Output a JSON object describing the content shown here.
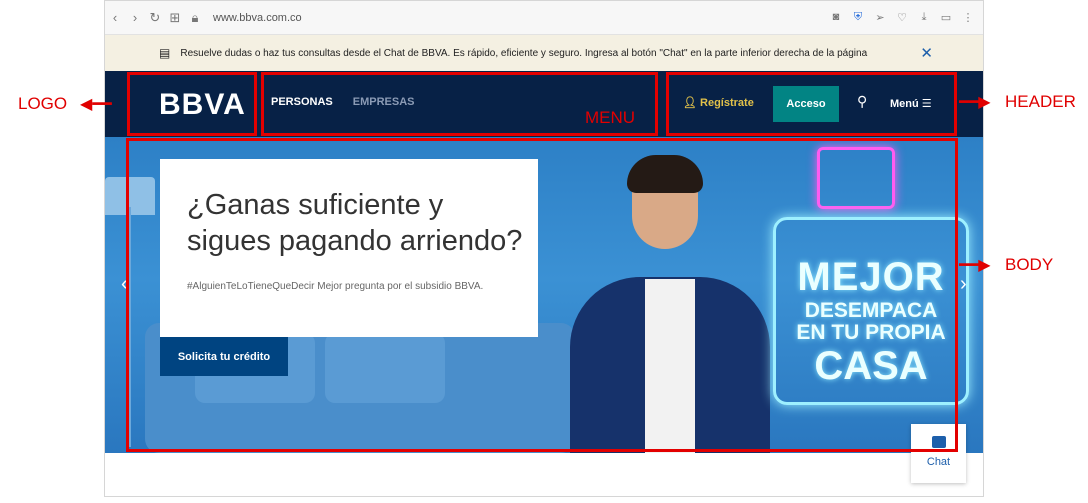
{
  "browser": {
    "url": "www.bbva.com.co",
    "nav_icons": [
      "back-icon",
      "forward-icon",
      "reload-icon",
      "apps-icon",
      "lock-icon"
    ],
    "toolbar_icons": [
      "camera-icon",
      "shield-icon",
      "send-icon",
      "heart-icon",
      "download-icon",
      "battery-icon",
      "more-icon"
    ]
  },
  "chat_banner": {
    "text": "Resuelve dudas o haz tus consultas desde el Chat de BBVA. Es rápido, eficiente y seguro. Ingresa al botón \"Chat\" en la parte inferior derecha de la página",
    "close": "✕"
  },
  "header": {
    "logo": "BBVA",
    "nav": [
      {
        "label": "PERSONAS",
        "active": true
      },
      {
        "label": "EMPRESAS",
        "active": false
      }
    ],
    "registrate": "Regístrate",
    "acceso": "Acceso",
    "menu": "Menú"
  },
  "hero": {
    "title": "¿Ganas suficiente y sigues pagando arriendo?",
    "subtitle": "#AlguienTeLoTieneQueDecir Mejor pregunta por el subsidio BBVA.",
    "cta": "Solicita tu crédito",
    "neon_line1": "MEJOR",
    "neon_line2": "DESEMPACA",
    "neon_line3": "EN TU PROPIA",
    "neon_line4": "CASA"
  },
  "chat_button": {
    "label": "Chat"
  },
  "annotations": {
    "logo": "LOGO",
    "menu": "MENU",
    "header": "HEADER",
    "body": "BODY"
  },
  "colors": {
    "header_bg": "#072146",
    "acceso": "#028484",
    "cta": "#004481",
    "registrate": "#e1c14a",
    "annotation": "#e30000"
  }
}
